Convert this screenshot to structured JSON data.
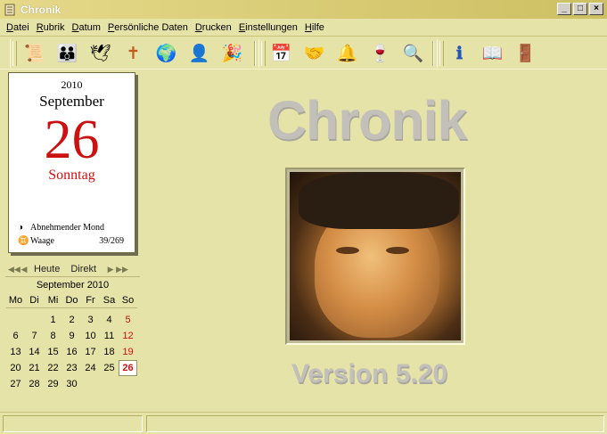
{
  "window": {
    "title": "Chronik",
    "buttons": [
      "_",
      "□",
      "×"
    ]
  },
  "menu": [
    "Datei",
    "Rubrik",
    "Datum",
    "Persönliche Daten",
    "Drucken",
    "Einstellungen",
    "Hilfe"
  ],
  "toolbar": {
    "group1": [
      {
        "icon": "scroll-icon",
        "glyph": "📜"
      },
      {
        "icon": "family-icon",
        "glyph": "👪"
      },
      {
        "icon": "stork-baby-icon",
        "glyph": "🕊"
      },
      {
        "icon": "grave-cross-icon",
        "glyph": "✝"
      },
      {
        "icon": "globe-icon",
        "glyph": "🌍"
      },
      {
        "icon": "saint-icon",
        "glyph": "👤"
      },
      {
        "icon": "celebration-icon",
        "glyph": "🎉"
      }
    ],
    "group2": [
      {
        "icon": "calendar-icon",
        "glyph": "📅"
      },
      {
        "icon": "handshake-icon",
        "glyph": "🤝"
      },
      {
        "icon": "bell-icon",
        "glyph": "🔔"
      },
      {
        "icon": "wine-icon",
        "glyph": "🍷"
      },
      {
        "icon": "search-icon",
        "glyph": "🔍"
      }
    ],
    "group3": [
      {
        "icon": "info-icon",
        "glyph": "ℹ"
      },
      {
        "icon": "help-book-icon",
        "glyph": "📖"
      },
      {
        "icon": "exit-door-icon",
        "glyph": "🚪"
      }
    ]
  },
  "calendar_card": {
    "year": "2010",
    "month": "September",
    "day": "26",
    "weekday": "Sonntag",
    "moon": "Abnehmender Mond",
    "moon_symbol": "◑",
    "zodiac_symbol": "♊",
    "zodiac": "Waage",
    "day_of_year": "39/269"
  },
  "date_nav": {
    "today": "Heute",
    "direct": "Direkt"
  },
  "mini_calendar": {
    "header": "September 2010",
    "weekdays": [
      "Mo",
      "Di",
      "Mi",
      "Do",
      "Fr",
      "Sa",
      "So"
    ],
    "rows": [
      [
        "",
        "",
        "1",
        "2",
        "3",
        "4",
        "5"
      ],
      [
        "6",
        "7",
        "8",
        "9",
        "10",
        "11",
        "12"
      ],
      [
        "13",
        "14",
        "15",
        "16",
        "17",
        "18",
        "19"
      ],
      [
        "20",
        "21",
        "22",
        "23",
        "24",
        "25",
        "26"
      ],
      [
        "27",
        "28",
        "29",
        "30",
        "",
        "",
        ""
      ]
    ],
    "selected": "26"
  },
  "splash": {
    "logo": "Chronik",
    "version": "Version 5.20"
  },
  "colors": {
    "accent_red": "#cc1111",
    "background": "#e6e3a8"
  }
}
